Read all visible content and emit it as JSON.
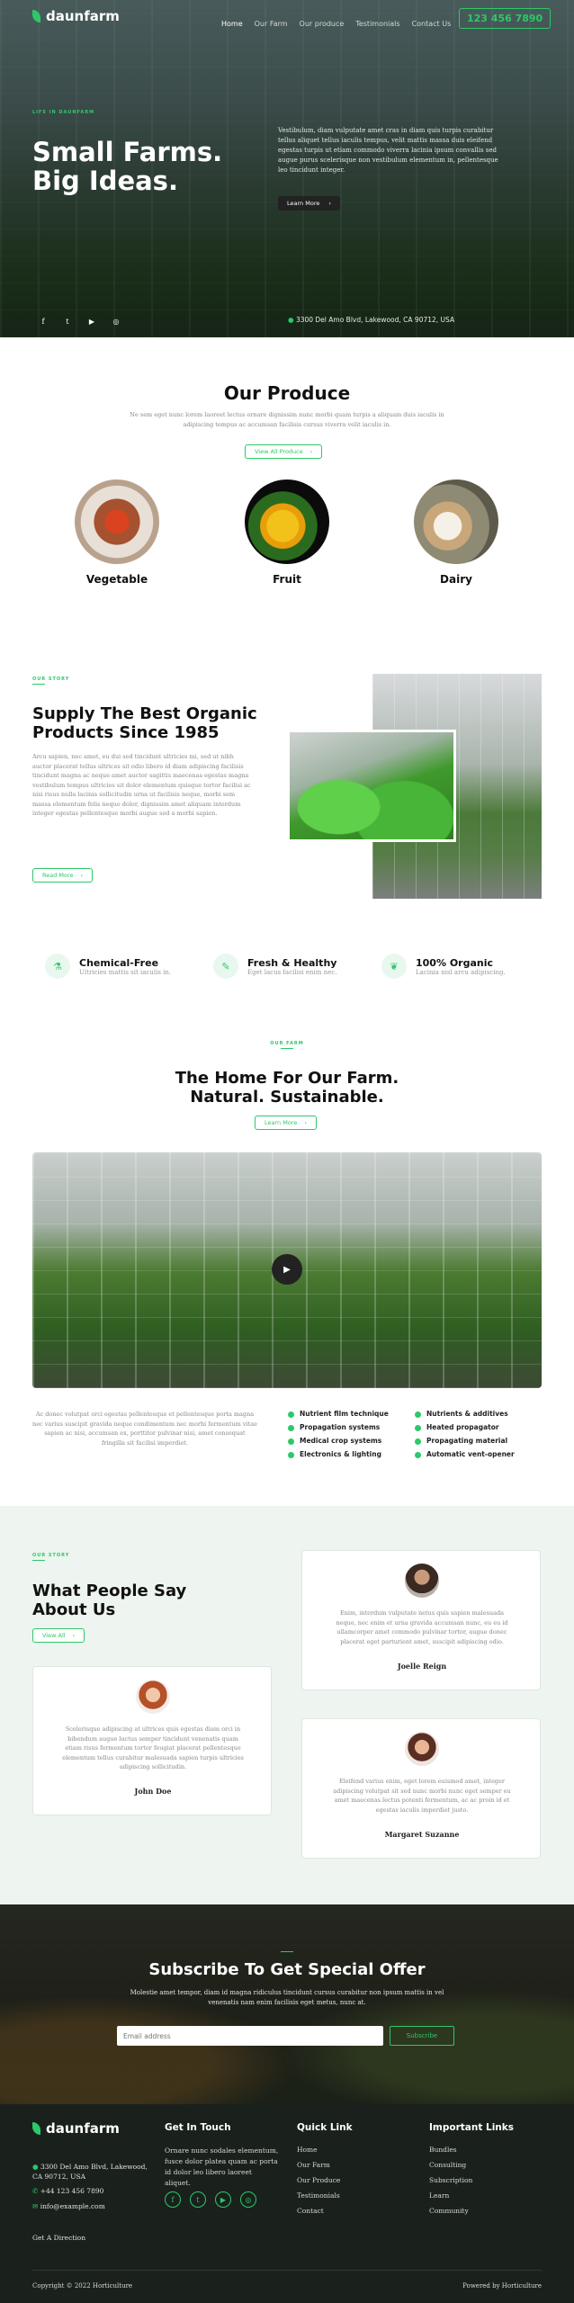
{
  "brand": {
    "name": "daunfarm",
    "accent": "#2dc86a"
  },
  "nav": {
    "items": [
      "Home",
      "Our Farm",
      "Our produce",
      "Testimonials",
      "Contact Us"
    ],
    "phone": "123 456 7890"
  },
  "hero": {
    "kicker": "Life in daunfarm",
    "title_line1": "Small Farms.",
    "title_line2": "Big Ideas.",
    "text": "Vestibulum, diam vulputate amet cras in diam quis turpis curabitur tellus aliquet tellus iaculis tempus, velit mattis massa duis eleifend egestas turpis ut etiam commodo viverra lacinia ipsum convallis sed augue purus scelerisque non vestibulum elementum in, pellentesque leo tincidunt integer.",
    "button": "Learn More",
    "address": "3300 Del Amo Blvd, Lakewood, CA 90712, USA"
  },
  "produce": {
    "title": "Our Produce",
    "text": "Ne sem eget nunc lorem laoreet lectus ornare dignissim nunc morbi quam turpis a aliquam duis iaculis in adipiscing tempus ac accumsan facilisis cursus viverra velit iaculis in.",
    "button": "View All Produce",
    "items": [
      "Vegetable",
      "Fruit",
      "Dairy"
    ]
  },
  "supply": {
    "kicker": "Our story",
    "title_line1": "Supply The Best Organic",
    "title_line2": "Products Since 1985",
    "text": "Arcu sapien, nec amet, eu dui sed tincidunt ultricies mi, sed ut nibh auctor placerat tellus ultrices sit odio libero id diam adipiscing facilisis tincidunt magna ac neque amet auctor sagittis maecenas egestas magna vestibulum tempus ultricies sit dolor elementum quisque tortor facilisi ac nisi risus nulla lacinia sollicitudin urna ut facilisis neque, morbi sem massa elementum felis neque dolor, dignissim amet aliquam interdum integer egestas pellentesque morbi augue sed a morbi sapien.",
    "button": "Read More"
  },
  "features": [
    {
      "title": "Chemical-Free",
      "text": "Ultricies mattis sit iaculis in."
    },
    {
      "title": "Fresh & Healthy",
      "text": "Eget lacus facilisi enim nec."
    },
    {
      "title": "100% Organic",
      "text": "Lacinia nisl arcu adipiscing."
    }
  ],
  "farm": {
    "kicker": "Our farm",
    "title_line1": "The Home For Our Farm.",
    "title_line2": "Natural. Sustainable.",
    "button": "Learn More",
    "text": "Ac donec volutpat orci egestas pellentesque et pellentesque porta magna nec varius suscipit gravida neque condimentum nec morbi fermentum vitae sapien ac nisi, accumsan ex, porttitor pulvinar nisi, amet consequat fringilla sit facilisi imperdiet.",
    "list_left": [
      "Nutrient film technique",
      "Propagation systems",
      "Medical crop systems",
      "Electronics & lighting"
    ],
    "list_right": [
      "Nutrients & additives",
      "Heated propagator",
      "Propagating material",
      "Automatic vent-opener"
    ]
  },
  "testimonials": {
    "kicker": "Our story",
    "title_line1": "What People Say",
    "title_line2": "About Us",
    "button": "View All",
    "items": [
      {
        "text": "Enim, interdum vulputate netus quis sapien malesuada neque, nec enim et urna gravida accumsan nunc, eu eu id ullamcorper amet commodo pulvinar tortor, augue donec placerat eget parturient amet, suscipit adipiscing odio.",
        "name": "Joelle Reign"
      },
      {
        "text": "Scelerisque adipiscing at ultrices quis egestas diam orci in bibendum augue luctus semper tincidunt venenatis quam etiam risus fermentum tortor feugiat placerat pellentesque elementum tellus curabitur malesuada sapien turpis ultricies adipiscing sollicitudin.",
        "name": "John Doe"
      },
      {
        "text": "Eleifend varius enim, eget lorem euismod amet, integer adipiscing volutpat sit sed nunc morbi nunc eget semper eu amet maecenas lectus potenti fermentum, ac ac proin id et egestas iaculis imperdiet justo.",
        "name": "Margaret Suzanne"
      }
    ]
  },
  "subscribe": {
    "title": "Subscribe To Get Special Offer",
    "text": "Molestie amet tempor, diam id magna ridiculus tincidunt cursus curabitur non ipsum mattis in vel venenatis nam enim facilisis eget metus, nunc at.",
    "placeholder": "Email address",
    "button": "Subscribe"
  },
  "footer": {
    "address": "3300 Del Amo Blvd, Lakewood, CA 90712, USA",
    "phone": "+44 123 456 7890",
    "email": "info@example.com",
    "direction": "Get A Direction",
    "touch_title": "Get In Touch",
    "touch_text": "Ornare nunc sodales elementum, fusce dolor platea quam ac porta id dolor leo libero laoreet aliquet.",
    "quick_title": "Quick Link",
    "quick": [
      "Home",
      "Our Farm",
      "Our Produce",
      "Testimonials",
      "Contact"
    ],
    "important_title": "Important Links",
    "important": [
      "Bundles",
      "Consulting",
      "Subscription",
      "Learn",
      "Community"
    ],
    "copyright": "Copyright © 2022 Horticulture",
    "powered": "Powered by Horticulture"
  }
}
